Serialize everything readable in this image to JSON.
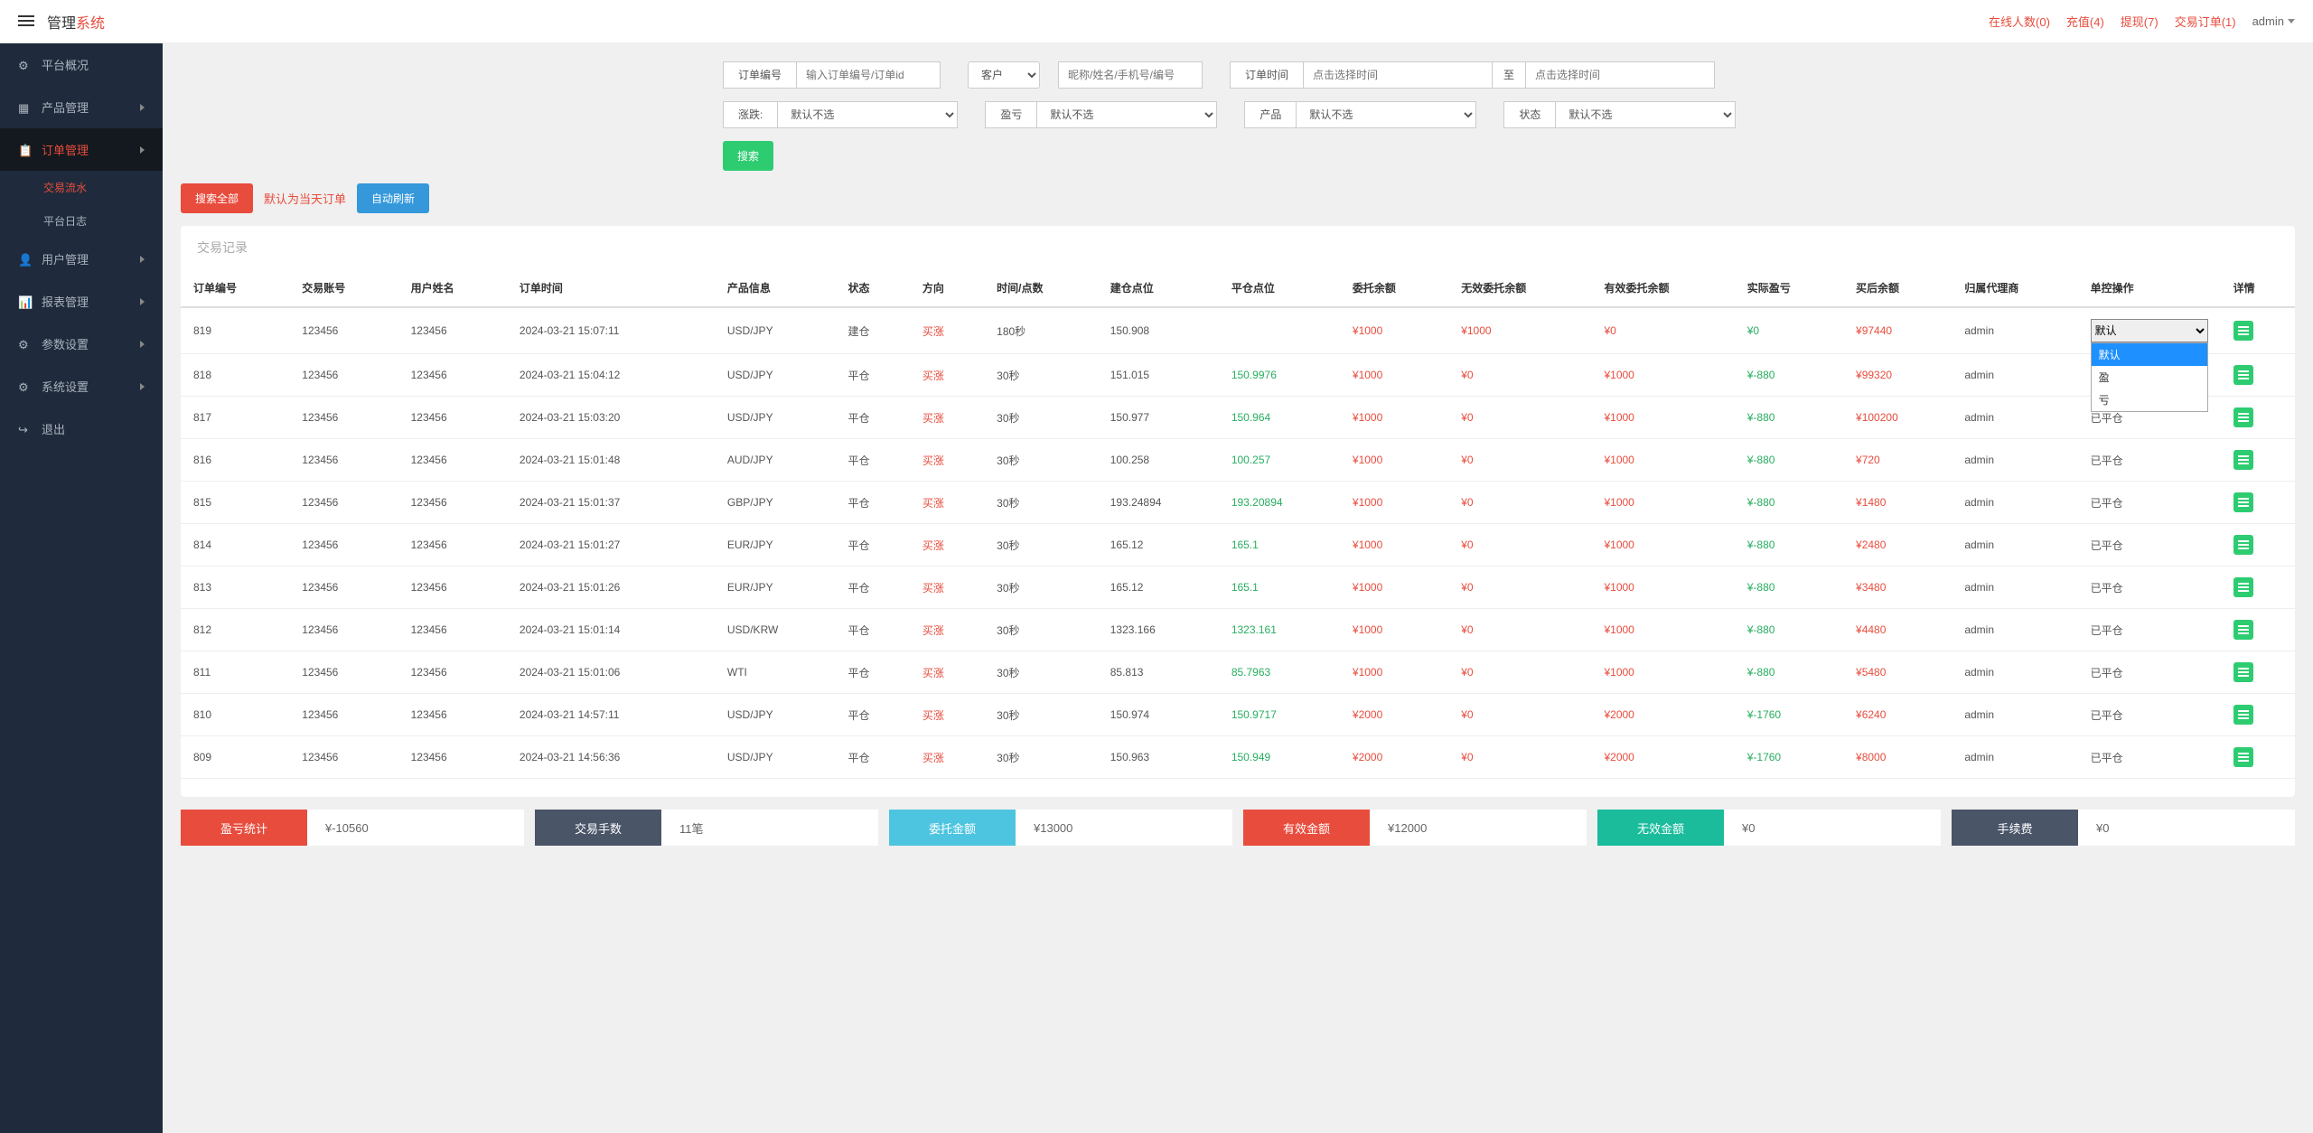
{
  "header": {
    "title_prefix": "管理",
    "title_suffix": "系统",
    "stats": {
      "online": "在线人数(0)",
      "recharge": "充值(4)",
      "withdraw": "提现(7)",
      "trade": "交易订单(1)"
    },
    "user": "admin"
  },
  "sidebar": {
    "items": [
      {
        "label": "平台概况"
      },
      {
        "label": "产品管理"
      },
      {
        "label": "订单管理"
      },
      {
        "label": "用户管理"
      },
      {
        "label": "报表管理"
      },
      {
        "label": "参数设置"
      },
      {
        "label": "系统设置"
      },
      {
        "label": "退出"
      }
    ],
    "sub": {
      "trade_flow": "交易流水",
      "platform_log": "平台日志"
    }
  },
  "filters": {
    "order_id_label": "订单编号",
    "order_id_placeholder": "输入订单编号/订单id",
    "user_type_selected": "客户",
    "user_placeholder": "昵称/姓名/手机号/编号",
    "order_time_label": "订单时间",
    "time_placeholder": "点击选择时间",
    "to_label": "至",
    "updown_label": "涨跌:",
    "default_not_selected": "默认不选",
    "profit_label": "盈亏",
    "product_label": "产品",
    "status_label": "状态",
    "search_btn": "搜索"
  },
  "actions": {
    "search_all": "搜索全部",
    "default_today": "默认为当天订单",
    "auto_refresh": "自动刷新"
  },
  "table": {
    "title": "交易记录",
    "headers": {
      "order_id": "订单编号",
      "account": "交易账号",
      "username": "用户姓名",
      "order_time": "订单时间",
      "product": "产品信息",
      "status": "状态",
      "direction": "方向",
      "time_points": "时间/点数",
      "open_point": "建仓点位",
      "close_point": "平仓点位",
      "entrust_balance": "委托余额",
      "invalid_entrust": "无效委托余额",
      "valid_entrust": "有效委托余额",
      "actual_profit": "实际盈亏",
      "after_balance": "买后余额",
      "agent": "归属代理商",
      "control": "单控操作",
      "detail": "详情"
    },
    "rows": [
      {
        "id": "819",
        "acct": "123456",
        "user": "123456",
        "time": "2024-03-21 15:07:11",
        "prod": "USD/JPY",
        "status": "建仓",
        "dir": "买涨",
        "tp": "180秒",
        "open": "150.908",
        "close": "",
        "entrust": "¥1000",
        "invalid": "¥1000",
        "valid": "¥0",
        "profit": "¥0",
        "after": "¥97440",
        "agent": "admin",
        "control": "默认"
      },
      {
        "id": "818",
        "acct": "123456",
        "user": "123456",
        "time": "2024-03-21 15:04:12",
        "prod": "USD/JPY",
        "status": "平仓",
        "dir": "买涨",
        "tp": "30秒",
        "open": "151.015",
        "close": "150.9976",
        "entrust": "¥1000",
        "invalid": "¥0",
        "valid": "¥1000",
        "profit": "¥-880",
        "after": "¥99320",
        "agent": "admin",
        "control": "已平仓"
      },
      {
        "id": "817",
        "acct": "123456",
        "user": "123456",
        "time": "2024-03-21 15:03:20",
        "prod": "USD/JPY",
        "status": "平仓",
        "dir": "买涨",
        "tp": "30秒",
        "open": "150.977",
        "close": "150.964",
        "entrust": "¥1000",
        "invalid": "¥0",
        "valid": "¥1000",
        "profit": "¥-880",
        "after": "¥100200",
        "agent": "admin",
        "control": "已平仓"
      },
      {
        "id": "816",
        "acct": "123456",
        "user": "123456",
        "time": "2024-03-21 15:01:48",
        "prod": "AUD/JPY",
        "status": "平仓",
        "dir": "买涨",
        "tp": "30秒",
        "open": "100.258",
        "close": "100.257",
        "entrust": "¥1000",
        "invalid": "¥0",
        "valid": "¥1000",
        "profit": "¥-880",
        "after": "¥720",
        "agent": "admin",
        "control": "已平仓"
      },
      {
        "id": "815",
        "acct": "123456",
        "user": "123456",
        "time": "2024-03-21 15:01:37",
        "prod": "GBP/JPY",
        "status": "平仓",
        "dir": "买涨",
        "tp": "30秒",
        "open": "193.24894",
        "close": "193.20894",
        "entrust": "¥1000",
        "invalid": "¥0",
        "valid": "¥1000",
        "profit": "¥-880",
        "after": "¥1480",
        "agent": "admin",
        "control": "已平仓"
      },
      {
        "id": "814",
        "acct": "123456",
        "user": "123456",
        "time": "2024-03-21 15:01:27",
        "prod": "EUR/JPY",
        "status": "平仓",
        "dir": "买涨",
        "tp": "30秒",
        "open": "165.12",
        "close": "165.1",
        "entrust": "¥1000",
        "invalid": "¥0",
        "valid": "¥1000",
        "profit": "¥-880",
        "after": "¥2480",
        "agent": "admin",
        "control": "已平仓"
      },
      {
        "id": "813",
        "acct": "123456",
        "user": "123456",
        "time": "2024-03-21 15:01:26",
        "prod": "EUR/JPY",
        "status": "平仓",
        "dir": "买涨",
        "tp": "30秒",
        "open": "165.12",
        "close": "165.1",
        "entrust": "¥1000",
        "invalid": "¥0",
        "valid": "¥1000",
        "profit": "¥-880",
        "after": "¥3480",
        "agent": "admin",
        "control": "已平仓"
      },
      {
        "id": "812",
        "acct": "123456",
        "user": "123456",
        "time": "2024-03-21 15:01:14",
        "prod": "USD/KRW",
        "status": "平仓",
        "dir": "买涨",
        "tp": "30秒",
        "open": "1323.166",
        "close": "1323.161",
        "entrust": "¥1000",
        "invalid": "¥0",
        "valid": "¥1000",
        "profit": "¥-880",
        "after": "¥4480",
        "agent": "admin",
        "control": "已平仓"
      },
      {
        "id": "811",
        "acct": "123456",
        "user": "123456",
        "time": "2024-03-21 15:01:06",
        "prod": "WTI",
        "status": "平仓",
        "dir": "买涨",
        "tp": "30秒",
        "open": "85.813",
        "close": "85.7963",
        "entrust": "¥1000",
        "invalid": "¥0",
        "valid": "¥1000",
        "profit": "¥-880",
        "after": "¥5480",
        "agent": "admin",
        "control": "已平仓"
      },
      {
        "id": "810",
        "acct": "123456",
        "user": "123456",
        "time": "2024-03-21 14:57:11",
        "prod": "USD/JPY",
        "status": "平仓",
        "dir": "买涨",
        "tp": "30秒",
        "open": "150.974",
        "close": "150.9717",
        "entrust": "¥2000",
        "invalid": "¥0",
        "valid": "¥2000",
        "profit": "¥-1760",
        "after": "¥6240",
        "agent": "admin",
        "control": "已平仓"
      },
      {
        "id": "809",
        "acct": "123456",
        "user": "123456",
        "time": "2024-03-21 14:56:36",
        "prod": "USD/JPY",
        "status": "平仓",
        "dir": "买涨",
        "tp": "30秒",
        "open": "150.963",
        "close": "150.949",
        "entrust": "¥2000",
        "invalid": "¥0",
        "valid": "¥2000",
        "profit": "¥-1760",
        "after": "¥8000",
        "agent": "admin",
        "control": "已平仓"
      }
    ],
    "control_options": {
      "default": "默认",
      "win": "盈",
      "loss": "亏"
    }
  },
  "summary": {
    "profit_stats_label": "盈亏统计",
    "profit_stats_value": "¥-10560",
    "trade_count_label": "交易手数",
    "trade_count_value": "11笔",
    "entrust_amt_label": "委托金额",
    "entrust_amt_value": "¥13000",
    "valid_amt_label": "有效金额",
    "valid_amt_value": "¥12000",
    "invalid_amt_label": "无效金额",
    "invalid_amt_value": "¥0",
    "fee_label": "手续费",
    "fee_value": "¥0"
  }
}
